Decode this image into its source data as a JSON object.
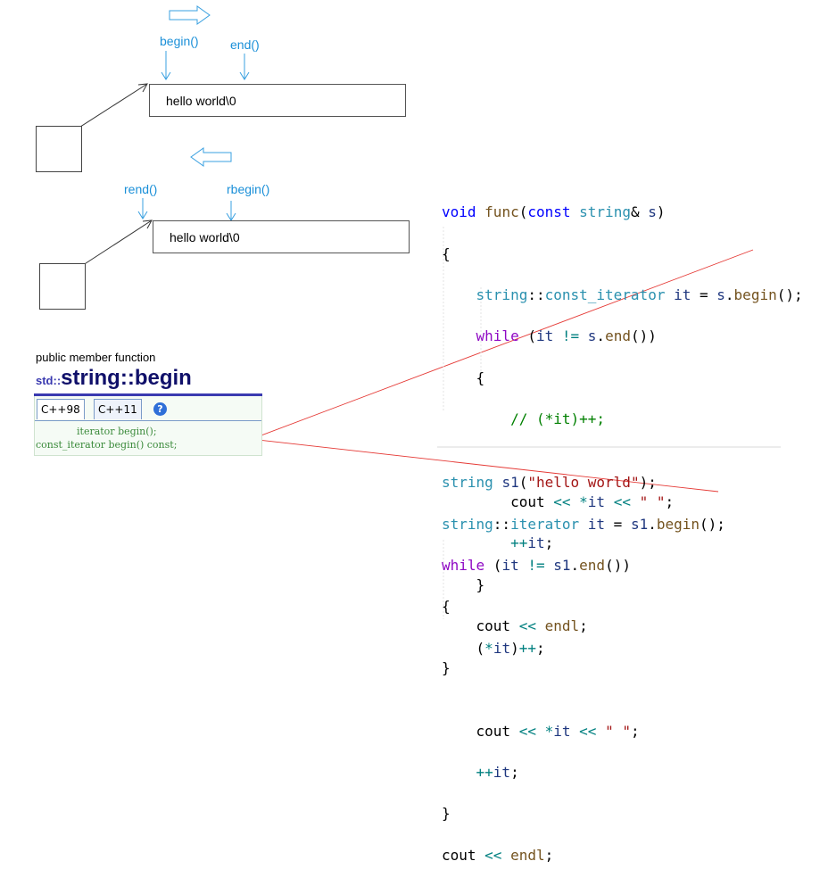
{
  "diagram1": {
    "begin_label": "begin()",
    "end_label": "end()",
    "string_text": "hello world\\0"
  },
  "diagram2": {
    "rend_label": "rend()",
    "rbegin_label": "rbegin()",
    "string_text": "hello world\\0"
  },
  "reference": {
    "kind": "public member function",
    "ns": "std::",
    "title": "string::begin",
    "tabs": [
      "C++98",
      "C++11"
    ],
    "help_icon": "question-icon",
    "signatures": [
      "iterator begin();",
      "const_iterator begin() const;"
    ]
  },
  "code1": {
    "lines": [
      "void func(const string& s)",
      "{",
      "    string::const_iterator it = s.begin();",
      "    while (it != s.end())",
      "    {",
      "        // (*it)++;",
      "",
      "        cout << *it << \" \";",
      "        ++it;",
      "    }",
      "    cout << endl;",
      "}"
    ]
  },
  "code2": {
    "lines": [
      "string s1(\"hello world\");",
      "string::iterator it = s1.begin();",
      "while (it != s1.end())",
      "{",
      "    (*it)++;",
      "",
      "    cout << *it << \" \";",
      "    ++it;",
      "}",
      "cout << endl;"
    ]
  },
  "colors": {
    "label_blue": "#1a8fd8",
    "annotation_red": "#e53935",
    "ref_green": "#3a8a3a",
    "ref_title": "#10106a"
  }
}
